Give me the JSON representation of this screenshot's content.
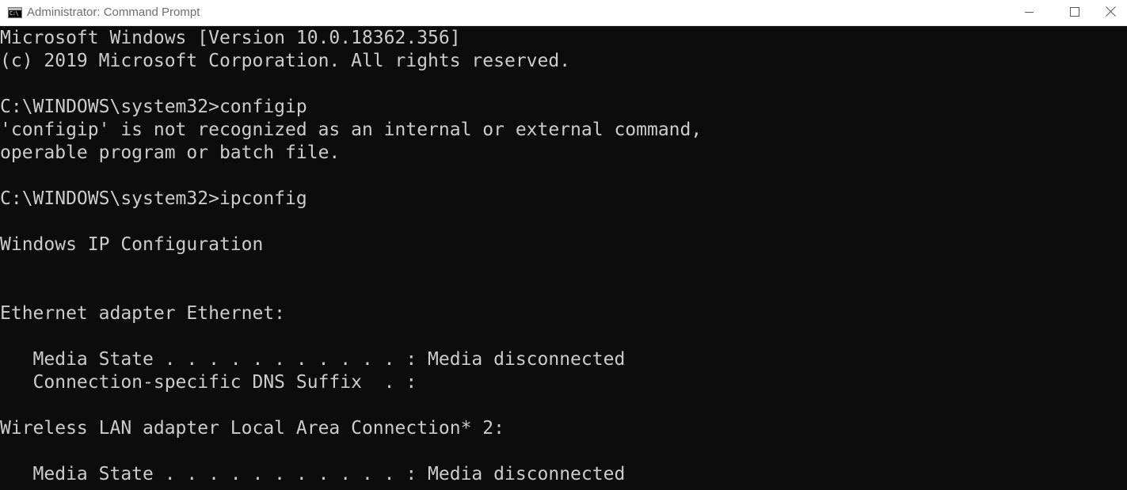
{
  "window": {
    "title": "Administrator: Command Prompt",
    "icon_glyph": "C:\\"
  },
  "colors": {
    "console_bg": "#0c0c0c",
    "console_text": "#cccccc",
    "titlebar_bg": "#ffffff"
  },
  "icons": {
    "app": "cmd-icon",
    "minimize": "minimize-icon",
    "maximize": "maximize-icon",
    "close": "close-icon"
  },
  "console": {
    "lines": [
      "Microsoft Windows [Version 10.0.18362.356]",
      "(c) 2019 Microsoft Corporation. All rights reserved.",
      "",
      "C:\\WINDOWS\\system32>configip",
      "'configip' is not recognized as an internal or external command,",
      "operable program or batch file.",
      "",
      "C:\\WINDOWS\\system32>ipconfig",
      "",
      "Windows IP Configuration",
      "",
      "",
      "Ethernet adapter Ethernet:",
      "",
      "   Media State . . . . . . . . . . . : Media disconnected",
      "   Connection-specific DNS Suffix  . :",
      "",
      "Wireless LAN adapter Local Area Connection* 2:",
      "",
      "   Media State . . . . . . . . . . . : Media disconnected"
    ]
  }
}
